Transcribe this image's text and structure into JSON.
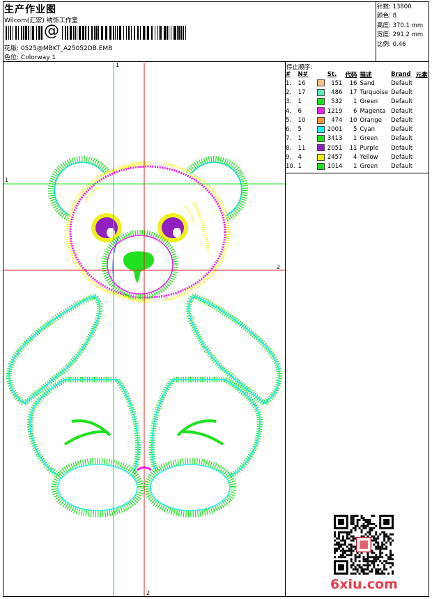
{
  "header": {
    "title": "生产作业图",
    "company": "Wilcom(汇宏) 绣饰工作室",
    "barcode_char": "@",
    "file_label": "花版:",
    "file_name": "0525@MBKT_A25052DB.EMB",
    "colorway_label": "色位:",
    "colorway_name": "Colorway 1"
  },
  "stats": [
    {
      "label": "针数:",
      "value": "13800"
    },
    {
      "label": "颜色:",
      "value": "8"
    },
    {
      "label": "高度:",
      "value": "370.1 mm"
    },
    {
      "label": "宽度:",
      "value": "291.2 mm"
    },
    {
      "label": "比例:",
      "value": "0.46"
    }
  ],
  "stop_sequence": {
    "heading": "停止顺序:",
    "columns": [
      "#",
      "N#",
      "St.",
      "代码",
      "描述",
      "Brand",
      "元素"
    ],
    "rows": [
      {
        "idx": "1.",
        "n": "16",
        "color": "#f8c088",
        "st": "151",
        "code": "16",
        "desc": "Sand",
        "brand": "Default"
      },
      {
        "idx": "2.",
        "n": "17",
        "color": "#60e8c0",
        "st": "486",
        "code": "17",
        "desc": "Turquoise",
        "brand": "Default"
      },
      {
        "idx": "3.",
        "n": "1",
        "color": "#20e020",
        "st": "532",
        "code": "1",
        "desc": "Green",
        "brand": "Default"
      },
      {
        "idx": "4.",
        "n": "6",
        "color": "#f020f0",
        "st": "1219",
        "code": "6",
        "desc": "Magenta",
        "brand": "Default"
      },
      {
        "idx": "5.",
        "n": "10",
        "color": "#f89840",
        "st": "474",
        "code": "10",
        "desc": "Orange",
        "brand": "Default"
      },
      {
        "idx": "6.",
        "n": "5",
        "color": "#20f0f0",
        "st": "2001",
        "code": "5",
        "desc": "Cyan",
        "brand": "Default"
      },
      {
        "idx": "7.",
        "n": "1",
        "color": "#20e020",
        "st": "3413",
        "code": "1",
        "desc": "Green",
        "brand": "Default"
      },
      {
        "idx": "8.",
        "n": "11",
        "color": "#9020c0",
        "st": "2051",
        "code": "11",
        "desc": "Purple",
        "brand": "Default"
      },
      {
        "idx": "9.",
        "n": "4",
        "color": "#f0f020",
        "st": "2457",
        "code": "4",
        "desc": "Yellow",
        "brand": "Default"
      },
      {
        "idx": "10.",
        "n": "1",
        "color": "#20e020",
        "st": "1014",
        "code": "1",
        "desc": "Green",
        "brand": "Default"
      }
    ]
  },
  "guides": {
    "label_1": "1",
    "label_2": "2"
  },
  "watermark": "6xiu.com",
  "colors": {
    "guide_green": "#20e020",
    "guide_red": "#e02020",
    "watermark": "#e63c50"
  }
}
